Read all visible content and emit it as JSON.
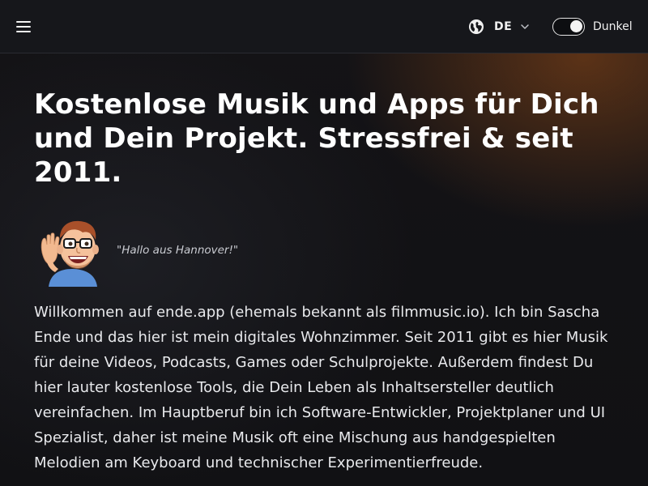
{
  "header": {
    "menu_icon": "hamburger-menu-icon",
    "language": {
      "icon": "globe-icon",
      "code": "DE",
      "dropdown_icon": "chevron-down-icon"
    },
    "theme_toggle": {
      "label": "Dunkel",
      "state": "on"
    }
  },
  "hero": {
    "headline": "Kostenlose Musik und Apps für Dich und Dein Projekt. Stressfrei & seit 2011.",
    "greeting": "\"Hallo aus Hannover!\"",
    "intro": "Willkommen auf ende.app (ehemals bekannt als filmmusic.io). Ich bin Sascha Ende und das hier ist mein digitales Wohnzimmer. Seit 2011 gibt es hier Musik für deine Videos, Podcasts, Games oder Schulprojekte. Außerdem findest Du hier lauter kostenlose Tools, die Dein Leben als Inhaltsersteller deutlich vereinfachen. Im Hauptberuf bin ich Software-Entwickler, Projektplaner und UI Spezialist, daher ist meine Musik oft eine Mischung aus handgespielten Melodien am Keyboard und technischer Experimentierfreude."
  },
  "colors": {
    "background": "#121215",
    "header_background": "#16171b",
    "accent_glow": "#964c18",
    "text": "#ffffff"
  }
}
